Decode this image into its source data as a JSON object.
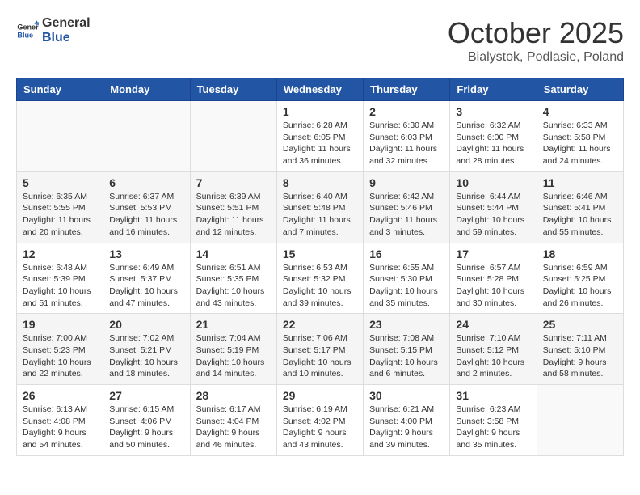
{
  "header": {
    "logo_line1": "General",
    "logo_line2": "Blue",
    "month": "October 2025",
    "location": "Bialystok, Podlasie, Poland"
  },
  "weekdays": [
    "Sunday",
    "Monday",
    "Tuesday",
    "Wednesday",
    "Thursday",
    "Friday",
    "Saturday"
  ],
  "weeks": [
    [
      {
        "day": "",
        "info": ""
      },
      {
        "day": "",
        "info": ""
      },
      {
        "day": "",
        "info": ""
      },
      {
        "day": "1",
        "info": "Sunrise: 6:28 AM\nSunset: 6:05 PM\nDaylight: 11 hours\nand 36 minutes."
      },
      {
        "day": "2",
        "info": "Sunrise: 6:30 AM\nSunset: 6:03 PM\nDaylight: 11 hours\nand 32 minutes."
      },
      {
        "day": "3",
        "info": "Sunrise: 6:32 AM\nSunset: 6:00 PM\nDaylight: 11 hours\nand 28 minutes."
      },
      {
        "day": "4",
        "info": "Sunrise: 6:33 AM\nSunset: 5:58 PM\nDaylight: 11 hours\nand 24 minutes."
      }
    ],
    [
      {
        "day": "5",
        "info": "Sunrise: 6:35 AM\nSunset: 5:55 PM\nDaylight: 11 hours\nand 20 minutes."
      },
      {
        "day": "6",
        "info": "Sunrise: 6:37 AM\nSunset: 5:53 PM\nDaylight: 11 hours\nand 16 minutes."
      },
      {
        "day": "7",
        "info": "Sunrise: 6:39 AM\nSunset: 5:51 PM\nDaylight: 11 hours\nand 12 minutes."
      },
      {
        "day": "8",
        "info": "Sunrise: 6:40 AM\nSunset: 5:48 PM\nDaylight: 11 hours\nand 7 minutes."
      },
      {
        "day": "9",
        "info": "Sunrise: 6:42 AM\nSunset: 5:46 PM\nDaylight: 11 hours\nand 3 minutes."
      },
      {
        "day": "10",
        "info": "Sunrise: 6:44 AM\nSunset: 5:44 PM\nDaylight: 10 hours\nand 59 minutes."
      },
      {
        "day": "11",
        "info": "Sunrise: 6:46 AM\nSunset: 5:41 PM\nDaylight: 10 hours\nand 55 minutes."
      }
    ],
    [
      {
        "day": "12",
        "info": "Sunrise: 6:48 AM\nSunset: 5:39 PM\nDaylight: 10 hours\nand 51 minutes."
      },
      {
        "day": "13",
        "info": "Sunrise: 6:49 AM\nSunset: 5:37 PM\nDaylight: 10 hours\nand 47 minutes."
      },
      {
        "day": "14",
        "info": "Sunrise: 6:51 AM\nSunset: 5:35 PM\nDaylight: 10 hours\nand 43 minutes."
      },
      {
        "day": "15",
        "info": "Sunrise: 6:53 AM\nSunset: 5:32 PM\nDaylight: 10 hours\nand 39 minutes."
      },
      {
        "day": "16",
        "info": "Sunrise: 6:55 AM\nSunset: 5:30 PM\nDaylight: 10 hours\nand 35 minutes."
      },
      {
        "day": "17",
        "info": "Sunrise: 6:57 AM\nSunset: 5:28 PM\nDaylight: 10 hours\nand 30 minutes."
      },
      {
        "day": "18",
        "info": "Sunrise: 6:59 AM\nSunset: 5:25 PM\nDaylight: 10 hours\nand 26 minutes."
      }
    ],
    [
      {
        "day": "19",
        "info": "Sunrise: 7:00 AM\nSunset: 5:23 PM\nDaylight: 10 hours\nand 22 minutes."
      },
      {
        "day": "20",
        "info": "Sunrise: 7:02 AM\nSunset: 5:21 PM\nDaylight: 10 hours\nand 18 minutes."
      },
      {
        "day": "21",
        "info": "Sunrise: 7:04 AM\nSunset: 5:19 PM\nDaylight: 10 hours\nand 14 minutes."
      },
      {
        "day": "22",
        "info": "Sunrise: 7:06 AM\nSunset: 5:17 PM\nDaylight: 10 hours\nand 10 minutes."
      },
      {
        "day": "23",
        "info": "Sunrise: 7:08 AM\nSunset: 5:15 PM\nDaylight: 10 hours\nand 6 minutes."
      },
      {
        "day": "24",
        "info": "Sunrise: 7:10 AM\nSunset: 5:12 PM\nDaylight: 10 hours\nand 2 minutes."
      },
      {
        "day": "25",
        "info": "Sunrise: 7:11 AM\nSunset: 5:10 PM\nDaylight: 9 hours\nand 58 minutes."
      }
    ],
    [
      {
        "day": "26",
        "info": "Sunrise: 6:13 AM\nSunset: 4:08 PM\nDaylight: 9 hours\nand 54 minutes."
      },
      {
        "day": "27",
        "info": "Sunrise: 6:15 AM\nSunset: 4:06 PM\nDaylight: 9 hours\nand 50 minutes."
      },
      {
        "day": "28",
        "info": "Sunrise: 6:17 AM\nSunset: 4:04 PM\nDaylight: 9 hours\nand 46 minutes."
      },
      {
        "day": "29",
        "info": "Sunrise: 6:19 AM\nSunset: 4:02 PM\nDaylight: 9 hours\nand 43 minutes."
      },
      {
        "day": "30",
        "info": "Sunrise: 6:21 AM\nSunset: 4:00 PM\nDaylight: 9 hours\nand 39 minutes."
      },
      {
        "day": "31",
        "info": "Sunrise: 6:23 AM\nSunset: 3:58 PM\nDaylight: 9 hours\nand 35 minutes."
      },
      {
        "day": "",
        "info": ""
      }
    ]
  ]
}
